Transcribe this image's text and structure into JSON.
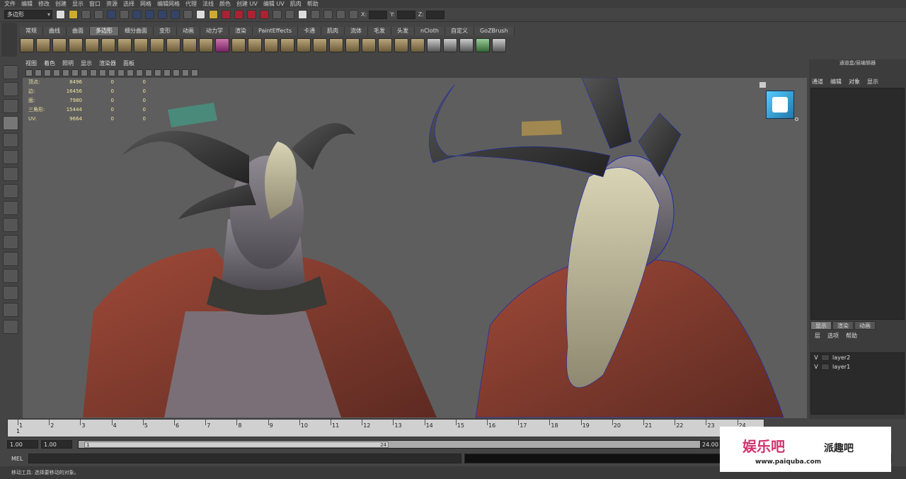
{
  "menubar": [
    "文件",
    "编辑",
    "修改",
    "创建",
    "显示",
    "窗口",
    "资源",
    "选择",
    "网格",
    "编辑网格",
    "代理",
    "法线",
    "颜色",
    "创建 UV",
    "编辑 UV",
    "肌肉",
    "帮助"
  ],
  "statusline": {
    "mode": "多边形",
    "x_label": "X:",
    "y_label": "Y:",
    "z_label": "Z:"
  },
  "shelf_tabs": [
    "常规",
    "曲线",
    "曲面",
    "多边形",
    "细分曲面",
    "变形",
    "动画",
    "动力学",
    "渲染",
    "PaintEffects",
    "卡通",
    "肌肉",
    "流体",
    "毛发",
    "头发",
    "nCloth",
    "自定义",
    "GoZBrush"
  ],
  "shelf_active": "多边形",
  "panel_menu": [
    "视图",
    "着色",
    "照明",
    "显示",
    "渲染器",
    "面板"
  ],
  "hud": {
    "rows": [
      {
        "label": "顶点:",
        "v1": "8496",
        "v2": "0",
        "v3": "0"
      },
      {
        "label": "边:",
        "v1": "16456",
        "v2": "0",
        "v3": "0"
      },
      {
        "label": "面:",
        "v1": "7980",
        "v2": "0",
        "v3": "0"
      },
      {
        "label": "三角形:",
        "v1": "15444",
        "v2": "0",
        "v3": "0"
      },
      {
        "label": "UV:",
        "v1": "9664",
        "v2": "0",
        "v3": "0"
      }
    ]
  },
  "right_panel": {
    "title": "通道盒/层编辑器",
    "menu": [
      "通道",
      "编辑",
      "对象",
      "显示"
    ],
    "layer_tabs": [
      "显示",
      "渲染",
      "动画"
    ],
    "layer_active": "显示",
    "layer_menu": [
      "层",
      "选项",
      "帮助"
    ],
    "layers": [
      {
        "vis": "V",
        "name": "layer2"
      },
      {
        "vis": "V",
        "name": "layer1"
      }
    ]
  },
  "timeline": {
    "ticks": [
      "1",
      "2",
      "3",
      "4",
      "5",
      "6",
      "7",
      "8",
      "9",
      "10",
      "11",
      "12",
      "13",
      "14",
      "15",
      "16",
      "17",
      "18",
      "19",
      "20",
      "21",
      "22",
      "23",
      "24"
    ],
    "current": "1"
  },
  "range": {
    "start": "1.00",
    "start2": "1.00",
    "inner_start": "1",
    "inner_end": "24",
    "end": "24.00"
  },
  "cmdline": {
    "label": "MEL"
  },
  "helpline": {
    "text": "移动工具: 选择要移动的对象。"
  },
  "watermark": {
    "logo": "娱乐吧",
    "name": "派趣吧",
    "url": "www.paiquba.com"
  }
}
